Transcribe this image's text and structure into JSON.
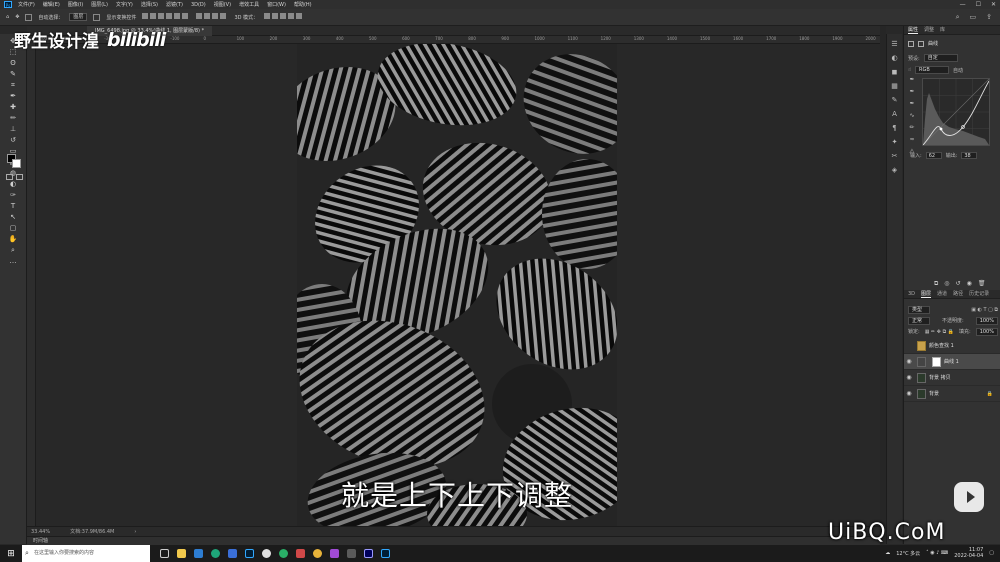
{
  "menubar": {
    "app_logo": "Ps",
    "items": [
      "文件(F)",
      "编辑(E)",
      "图像(I)",
      "图层(L)",
      "文字(Y)",
      "选择(S)",
      "滤镜(T)",
      "3D(D)",
      "视图(V)",
      "增效工具",
      "窗口(W)",
      "帮助(H)"
    ],
    "window_controls": [
      "—",
      "☐",
      "✕"
    ]
  },
  "options_bar": {
    "auto_select_label": "自动选择：",
    "auto_select_target": "图层",
    "show_transform_label": "显示变换控件",
    "mode3d_label": "3D 模式："
  },
  "document_tab": {
    "title": "IMG_6498.jpg @ 33.4%(曲线 1, 图层蒙版/8) *"
  },
  "ruler": {
    "ticks": [
      "-500",
      "-450",
      "-400",
      "-350",
      "-300",
      "-250",
      "-200",
      "-150",
      "-100",
      "-50",
      "0",
      "50",
      "100",
      "150",
      "200",
      "250",
      "300",
      "350",
      "400",
      "450",
      "500",
      "550",
      "600",
      "650",
      "700",
      "750",
      "800",
      "850",
      "900",
      "950",
      "1000",
      "1050",
      "1100",
      "1150",
      "1200",
      "1250",
      "1300",
      "1350",
      "1400",
      "1450",
      "1500",
      "1550",
      "1600",
      "1650",
      "1700",
      "1750",
      "1800",
      "1850",
      "1900",
      "1950",
      "2000"
    ]
  },
  "watermark": {
    "channel_name": "野生设计湟",
    "platform": "bilibili"
  },
  "subtitle": "就是上下上下调整",
  "status": {
    "zoom": "33.44%",
    "doc_info": "文档:37.9M/86.4M"
  },
  "timeline_label": "时间轴",
  "properties": {
    "tabs": [
      "属性",
      "调整",
      "库"
    ],
    "adjustment_name": "曲线",
    "preset_label": "预设:",
    "preset_value": "自定",
    "channel_value": "RGB",
    "auto_label": "自动",
    "input_label": "输入:",
    "input_value": "62",
    "output_label": "输出:",
    "output_value": "38"
  },
  "layers": {
    "tabs": [
      "3D",
      "图层",
      "通道",
      "路径",
      "历史记录"
    ],
    "kind_label": "类型",
    "blend_mode": "正常",
    "opacity_label": "不透明度:",
    "opacity_value": "100%",
    "lock_label": "锁定:",
    "fill_label": "填充:",
    "fill_value": "100%",
    "items": [
      {
        "name": "颜色查找 1"
      },
      {
        "name": "曲线 1"
      },
      {
        "name": "背景 拷贝"
      },
      {
        "name": "背景"
      }
    ]
  },
  "site_watermark": "UiBQ.CoM",
  "taskbar": {
    "search_placeholder": "在这里输入你要搜索的内容",
    "weather": "12°C 多云",
    "time": "11:07",
    "date": "2022-04-04"
  }
}
